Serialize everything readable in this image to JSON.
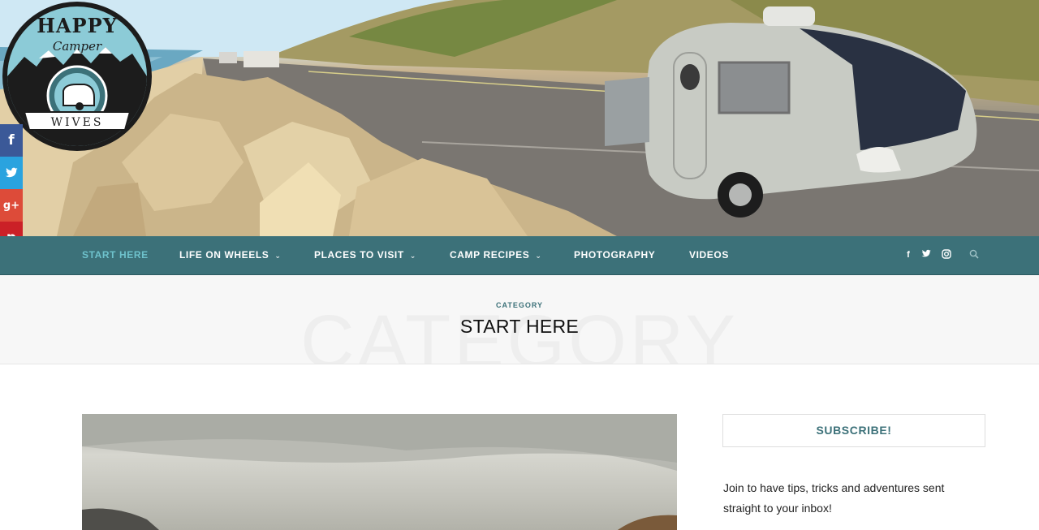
{
  "logo": {
    "line1": "HAPPY",
    "line2": "Camper",
    "line3": "WIVES"
  },
  "social_sidebar": [
    {
      "icon": "facebook-icon",
      "glyph": "f"
    },
    {
      "icon": "twitter-icon",
      "glyph": "t"
    },
    {
      "icon": "google-plus-icon",
      "glyph": "g+"
    },
    {
      "icon": "pinterest-icon",
      "glyph": "p"
    }
  ],
  "nav": {
    "items": [
      {
        "label": "START HERE",
        "active": true
      },
      {
        "label": "LIFE ON WHEELS",
        "dropdown": true
      },
      {
        "label": "PLACES TO VISIT",
        "dropdown": true
      },
      {
        "label": "CAMP RECIPES",
        "dropdown": true
      },
      {
        "label": "PHOTOGRAPHY"
      },
      {
        "label": "VIDEOS"
      }
    ],
    "caret": "⌄",
    "icons": {
      "facebook": "f",
      "twitter": "t",
      "instagram": "◎",
      "search": "⌕"
    }
  },
  "category": {
    "ghost": "CATEGORY",
    "label": "CATEGORY",
    "title": "START HERE"
  },
  "sidebar": {
    "subscribe_title": "SUBSCRIBE!",
    "subscribe_text": "Join to have tips, tricks and adventures sent straight to your inbox!"
  },
  "colors": {
    "nav_bg": "#3c7179",
    "nav_active": "#6ec2cc",
    "facebook": "#3b5998",
    "twitter": "#2aa3df",
    "google_plus": "#dd4b39",
    "pinterest": "#cb2027"
  }
}
